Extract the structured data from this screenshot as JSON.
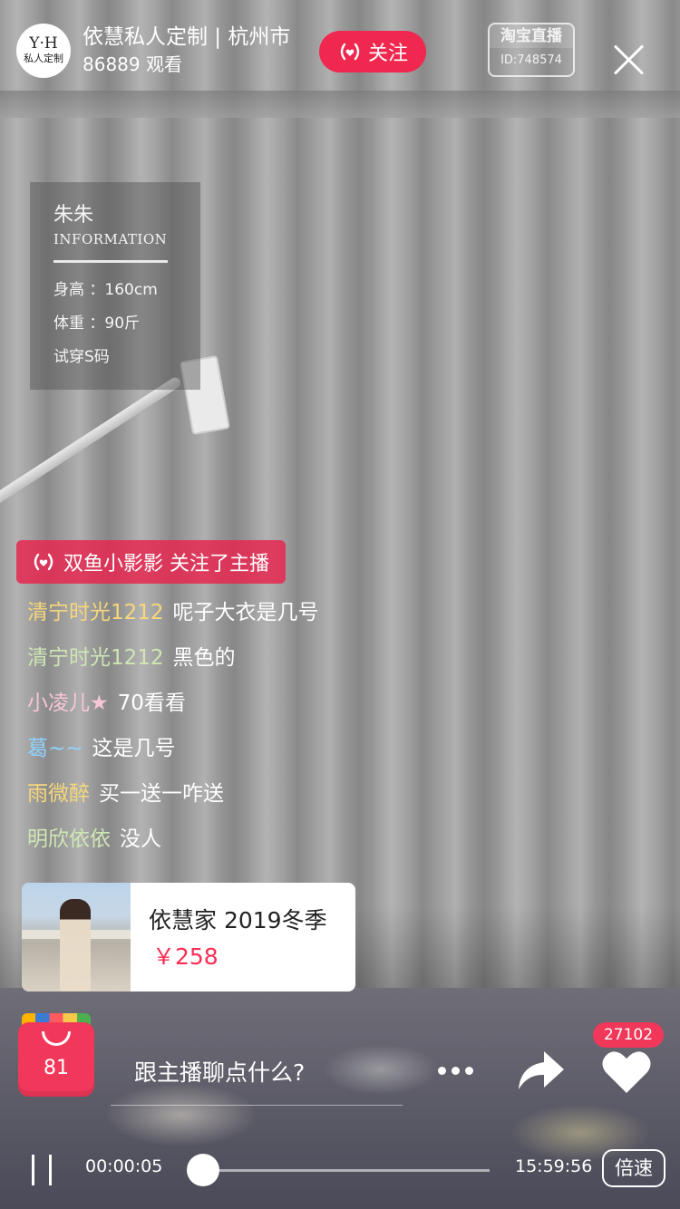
{
  "header": {
    "avatar_line1": "Y·H",
    "avatar_line2": "私人定制",
    "shop_name": "依慧私人定制 | 杭州市",
    "view_count": "86889 观看",
    "follow_label": "关注",
    "platform_badge": "淘宝直播",
    "live_id": "ID:748574"
  },
  "info_card": {
    "name": "朱朱",
    "tag": "INFORMATION",
    "height": "身高 ：160cm",
    "weight": "体重 ：90斤",
    "size": "试穿S码"
  },
  "follow_notice": "双鱼小影影 关注了主播",
  "comments": [
    {
      "user": "清宁时光1212",
      "text": "呢子大衣是几号",
      "color": "#f6d77b"
    },
    {
      "user": "清宁时光1212",
      "text": "黑色的",
      "color": "#cfe6b4"
    },
    {
      "user": "小凌儿★",
      "text": "70看看",
      "color": "#f7c6d6"
    },
    {
      "user": "葛~~",
      "text": "这是几号",
      "color": "#8fd3ff"
    },
    {
      "user": "雨微醉",
      "text": "买一送一咋送",
      "color": "#f6d77b"
    },
    {
      "user": "明欣依依",
      "text": "没人",
      "color": "#cfe6b4"
    }
  ],
  "product": {
    "title": "依慧家 2019冬季",
    "price": "￥258"
  },
  "bottom": {
    "cart_count": "81",
    "chat_placeholder": "跟主播聊点什么?",
    "like_count": "27102"
  },
  "player": {
    "current_time": "00:00:05",
    "total_time": "15:59:56",
    "speed_label": "倍速",
    "progress": 0.0
  },
  "colors": {
    "accent": "#f0284f",
    "price": "#ff2d55"
  }
}
